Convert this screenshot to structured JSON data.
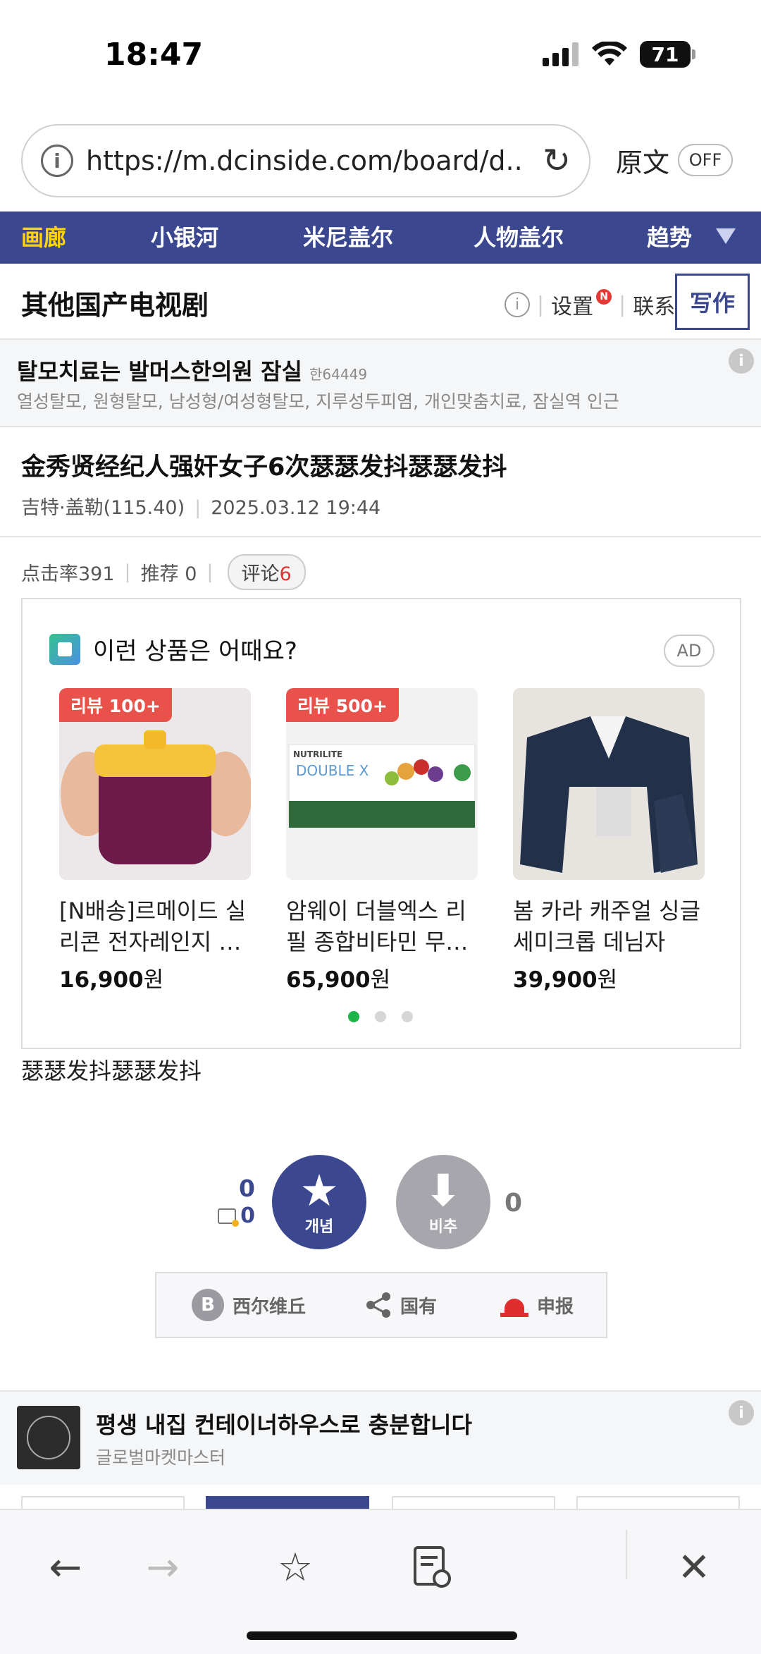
{
  "status": {
    "time": "18:47",
    "battery": "71"
  },
  "browser": {
    "url": "https://m.dcinside.com/board/d...",
    "translate_label": "原文",
    "translate_toggle": "OFF"
  },
  "nav": {
    "items": [
      "画廊",
      "小银河",
      "米尼盖尔",
      "人物盖尔",
      "趋势"
    ],
    "active_index": 0
  },
  "board": {
    "title": "其他国产电视剧",
    "settings_label": "设置",
    "new_badge": "N",
    "contact_label": "联系",
    "write_label": "写作"
  },
  "top_ad": {
    "title": "탈모치료는 발머스한의원 잠실",
    "tag": "한64449",
    "desc": "열성탈모, 원형탈모, 남성형/여성형탈모, 지루성두피염, 개인맞춤치료, 잠실역 인근"
  },
  "post": {
    "title": "金秀贤经纪人强奸女子6次瑟瑟发抖瑟瑟发抖",
    "author": "吉特·盖勒(115.40)",
    "date": "2025.03.12 19:44",
    "views_label": "点击率391",
    "recommend_label": "推荐 0",
    "comment_label": "评论",
    "comment_count": "6",
    "body": "瑟瑟发抖瑟瑟发抖"
  },
  "products": {
    "header": "이런 상품은 어때요?",
    "ad_label": "AD",
    "items": [
      {
        "badge": "리뷰 100+",
        "name": "[N배송]르메이드 실리콘 전자레인지 …",
        "price": "16,900",
        "unit": "원"
      },
      {
        "badge": "리뷰 500+",
        "name": "암웨이 더블엑스 리필 종합비타민 무…",
        "price": "65,900",
        "unit": "원"
      },
      {
        "badge": "",
        "name": "봄 카라 캐주얼 싱글 세미크롭 데님자켓…",
        "price": "39,900",
        "unit": "원"
      }
    ],
    "page_count": 3,
    "active_page": 0,
    "nutrilite_logo": "NUTRILITE",
    "nutrilite_product": "DOUBLE X"
  },
  "votes": {
    "up_count": "0",
    "fixed_up_count": "0",
    "up_label": "개념",
    "down_label": "비추",
    "down_count": "0"
  },
  "share": {
    "b_letter": "B",
    "bookmark_label": "西尔维丘",
    "share_label": "国有",
    "report_label": "申报"
  },
  "bottom_ad": {
    "title": "평생 내집 컨테이너하우스로 충분합니다",
    "sub": "글로벌마켓마스터"
  },
  "colors": {
    "brand": "#3b4890",
    "active_nav": "#ffd400",
    "review_badge": "#e8524a",
    "dot_active": "#1db44a"
  }
}
